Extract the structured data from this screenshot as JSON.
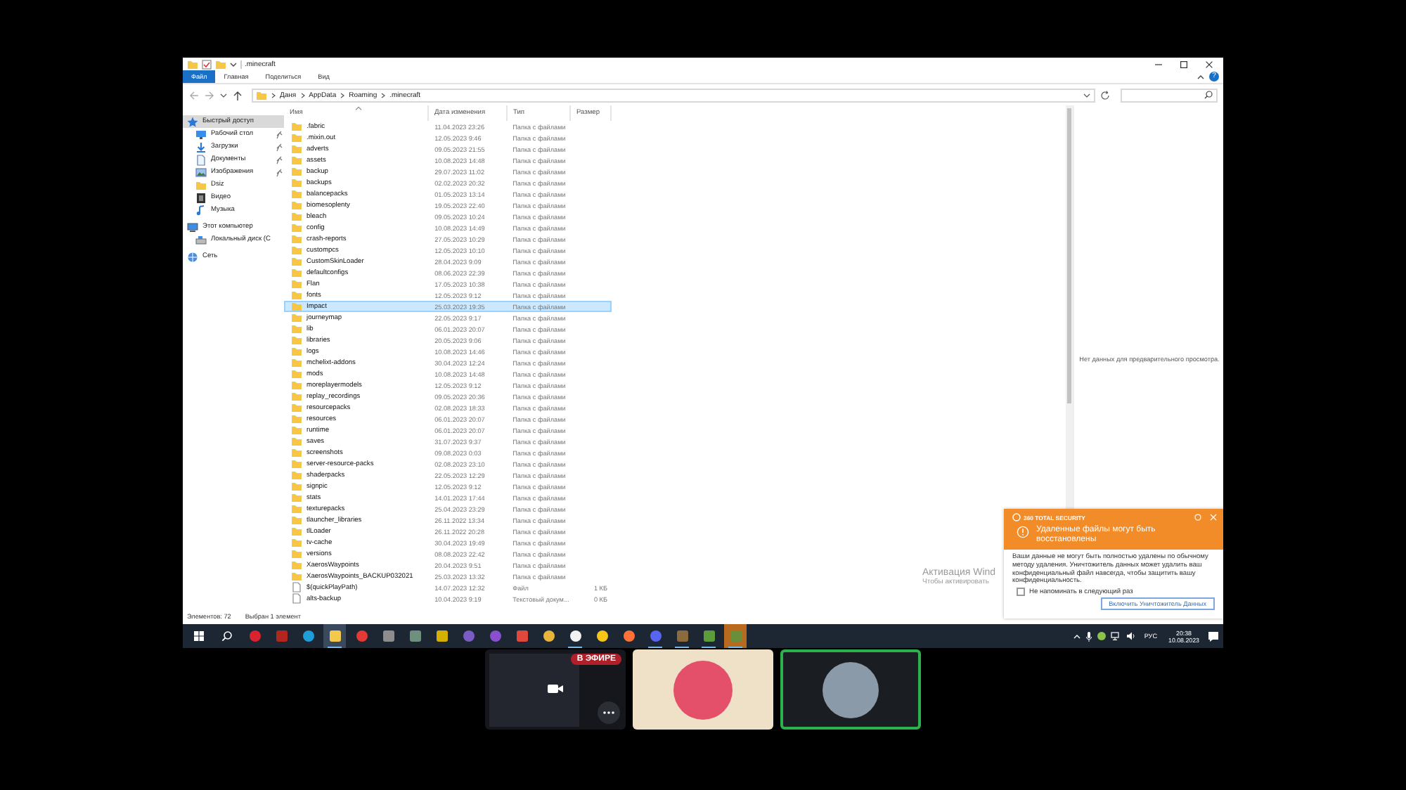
{
  "explorer": {
    "title": ".minecraft",
    "ribbon_tabs": [
      {
        "label": "Файл",
        "selected": true
      },
      {
        "label": "Главная",
        "selected": false
      },
      {
        "label": "Поделиться",
        "selected": false
      },
      {
        "label": "Вид",
        "selected": false
      }
    ],
    "help": "?",
    "breadcrumb": [
      "Даня",
      "AppData",
      "Roaming",
      ".minecraft"
    ],
    "nav": [
      {
        "label": "Быстрый доступ",
        "kind": "star",
        "selected": true,
        "pinned": false,
        "children": [
          {
            "label": "Рабочий стол",
            "kind": "desktop",
            "selected": false,
            "pinned": true
          },
          {
            "label": "Загрузки",
            "kind": "download",
            "selected": false,
            "pinned": true
          },
          {
            "label": "Документы",
            "kind": "document",
            "selected": false,
            "pinned": true
          },
          {
            "label": "Изображения",
            "kind": "picture",
            "selected": false,
            "pinned": true
          },
          {
            "label": "Dsiz",
            "kind": "folder",
            "selected": false,
            "pinned": false
          },
          {
            "label": "Видео",
            "kind": "video",
            "selected": false,
            "pinned": false
          },
          {
            "label": "Музыка",
            "kind": "music",
            "selected": false,
            "pinned": false
          }
        ]
      },
      {
        "label": "Этот компьютер",
        "kind": "computer",
        "selected": false,
        "pinned": false,
        "children": [
          {
            "label": "Локальный диск (C",
            "kind": "drive",
            "selected": false,
            "pinned": false
          }
        ]
      },
      {
        "label": "Сеть",
        "kind": "network",
        "selected": false,
        "pinned": false
      }
    ],
    "columns": [
      "Имя",
      "Дата изменения",
      "Тип",
      "Размер"
    ],
    "rows": [
      {
        "name": ".fabric",
        "date": "11.04.2023 23:26",
        "type": "Папка с файлами",
        "kind": "folder",
        "selected": false
      },
      {
        "name": ".mixin.out",
        "date": "12.05.2023 9:46",
        "type": "Папка с файлами",
        "kind": "folder",
        "selected": false
      },
      {
        "name": "adverts",
        "date": "09.05.2023 21:55",
        "type": "Папка с файлами",
        "kind": "folder",
        "selected": false
      },
      {
        "name": "assets",
        "date": "10.08.2023 14:48",
        "type": "Папка с файлами",
        "kind": "folder",
        "selected": false
      },
      {
        "name": "backup",
        "date": "29.07.2023 11:02",
        "type": "Папка с файлами",
        "kind": "folder",
        "selected": false
      },
      {
        "name": "backups",
        "date": "02.02.2023 20:32",
        "type": "Папка с файлами",
        "kind": "folder",
        "selected": false
      },
      {
        "name": "balancepacks",
        "date": "01.05.2023 13:14",
        "type": "Папка с файлами",
        "kind": "folder",
        "selected": false
      },
      {
        "name": "biomesoplenty",
        "date": "19.05.2023 22:40",
        "type": "Папка с файлами",
        "kind": "folder",
        "selected": false
      },
      {
        "name": "bleach",
        "date": "09.05.2023 10:24",
        "type": "Папка с файлами",
        "kind": "folder",
        "selected": false
      },
      {
        "name": "config",
        "date": "10.08.2023 14:49",
        "type": "Папка с файлами",
        "kind": "folder",
        "selected": false
      },
      {
        "name": "crash-reports",
        "date": "27.05.2023 10:29",
        "type": "Папка с файлами",
        "kind": "folder",
        "selected": false
      },
      {
        "name": "custompcs",
        "date": "12.05.2023 10:10",
        "type": "Папка с файлами",
        "kind": "folder",
        "selected": false
      },
      {
        "name": "CustomSkinLoader",
        "date": "28.04.2023 9:09",
        "type": "Папка с файлами",
        "kind": "folder",
        "selected": false
      },
      {
        "name": "defaultconfigs",
        "date": "08.06.2023 22:39",
        "type": "Папка с файлами",
        "kind": "folder",
        "selected": false
      },
      {
        "name": "Flan",
        "date": "17.05.2023 10:38",
        "type": "Папка с файлами",
        "kind": "folder",
        "selected": false
      },
      {
        "name": "fonts",
        "date": "12.05.2023 9:12",
        "type": "Папка с файлами",
        "kind": "folder",
        "selected": false
      },
      {
        "name": "Impact",
        "date": "25.03.2023 19:35",
        "type": "Папка с файлами",
        "kind": "folder",
        "selected": true
      },
      {
        "name": "journeymap",
        "date": "22.05.2023 9:17",
        "type": "Папка с файлами",
        "kind": "folder",
        "selected": false
      },
      {
        "name": "lib",
        "date": "06.01.2023 20:07",
        "type": "Папка с файлами",
        "kind": "folder",
        "selected": false
      },
      {
        "name": "libraries",
        "date": "20.05.2023 9:06",
        "type": "Папка с файлами",
        "kind": "folder",
        "selected": false
      },
      {
        "name": "logs",
        "date": "10.08.2023 14:46",
        "type": "Папка с файлами",
        "kind": "folder",
        "selected": false
      },
      {
        "name": "mchelixt-addons",
        "date": "30.04.2023 12:24",
        "type": "Папка с файлами",
        "kind": "folder",
        "selected": false
      },
      {
        "name": "mods",
        "date": "10.08.2023 14:48",
        "type": "Папка с файлами",
        "kind": "folder",
        "selected": false
      },
      {
        "name": "moreplayermodels",
        "date": "12.05.2023 9:12",
        "type": "Папка с файлами",
        "kind": "folder",
        "selected": false
      },
      {
        "name": "replay_recordings",
        "date": "09.05.2023 20:36",
        "type": "Папка с файлами",
        "kind": "folder",
        "selected": false
      },
      {
        "name": "resourcepacks",
        "date": "02.08.2023 18:33",
        "type": "Папка с файлами",
        "kind": "folder",
        "selected": false
      },
      {
        "name": "resources",
        "date": "06.01.2023 20:07",
        "type": "Папка с файлами",
        "kind": "folder",
        "selected": false
      },
      {
        "name": "runtime",
        "date": "06.01.2023 20:07",
        "type": "Папка с файлами",
        "kind": "folder",
        "selected": false
      },
      {
        "name": "saves",
        "date": "31.07.2023 9:37",
        "type": "Папка с файлами",
        "kind": "folder",
        "selected": false
      },
      {
        "name": "screenshots",
        "date": "09.08.2023 0:03",
        "type": "Папка с файлами",
        "kind": "folder",
        "selected": false
      },
      {
        "name": "server-resource-packs",
        "date": "02.08.2023 23:10",
        "type": "Папка с файлами",
        "kind": "folder",
        "selected": false
      },
      {
        "name": "shaderpacks",
        "date": "22.05.2023 12:29",
        "type": "Папка с файлами",
        "kind": "folder",
        "selected": false
      },
      {
        "name": "signpic",
        "date": "12.05.2023 9:12",
        "type": "Папка с файлами",
        "kind": "folder",
        "selected": false
      },
      {
        "name": "stats",
        "date": "14.01.2023 17:44",
        "type": "Папка с файлами",
        "kind": "folder",
        "selected": false
      },
      {
        "name": "texturepacks",
        "date": "25.04.2023 23:29",
        "type": "Папка с файлами",
        "kind": "folder",
        "selected": false
      },
      {
        "name": "tlauncher_libraries",
        "date": "26.11.2022 13:34",
        "type": "Папка с файлами",
        "kind": "folder",
        "selected": false
      },
      {
        "name": "tlLoader",
        "date": "26.11.2022 20:28",
        "type": "Папка с файлами",
        "kind": "folder",
        "selected": false
      },
      {
        "name": "tv-cache",
        "date": "30.04.2023 19:49",
        "type": "Папка с файлами",
        "kind": "folder",
        "selected": false
      },
      {
        "name": "versions",
        "date": "08.08.2023 22:42",
        "type": "Папка с файлами",
        "kind": "folder",
        "selected": false
      },
      {
        "name": "XaerosWaypoints",
        "date": "20.04.2023 9:51",
        "type": "Папка с файлами",
        "kind": "folder",
        "selected": false
      },
      {
        "name": "XaerosWaypoints_BACKUP032021",
        "date": "25.03.2023 13:32",
        "type": "Папка с файлами",
        "kind": "folder",
        "selected": false
      },
      {
        "name": "$(quickPlayPath)",
        "date": "14.07.2023 12:32",
        "type": "Файл",
        "size": "1 КБ",
        "kind": "file",
        "selected": false
      },
      {
        "name": "alts-backup",
        "date": "10.04.2023 9:19",
        "type": "Текстовый докум...",
        "size": "0 КБ",
        "kind": "file",
        "selected": false
      }
    ],
    "preview": "Нет данных для предварительного просмотра.",
    "status": [
      "Элементов: 72",
      "Выбран 1 элемент"
    ]
  },
  "activation": {
    "title": "Активация Wind",
    "subtitle": "Чтобы активировать"
  },
  "notification": {
    "brand": "360 TOTAL SECURITY",
    "title": "Удаленные файлы могут быть восстановлены",
    "body": "Ваши данные не могут быть полностью удалены по обычному методу удаления. Уничтожитель данных может удалить ваш конфиденциальный файл навсегда, чтобы защитить вашу конфиденциальность.",
    "checkbox": {
      "label": "Не напоминать в следующий раз",
      "checked": false
    },
    "button": "Включить Уничтожитель Данных"
  },
  "taskbar": {
    "apps": [
      {
        "kind": "circle",
        "color": "#d9232e",
        "open": false,
        "selected": false
      },
      {
        "kind": "square",
        "color": "#b3261e",
        "open": false,
        "selected": false
      },
      {
        "kind": "circle",
        "color": "#1f9ed8",
        "open": false,
        "selected": false
      },
      {
        "kind": "square",
        "color": "#f2c94c",
        "open": true,
        "selected": true
      },
      {
        "kind": "circle",
        "color": "#e53935",
        "open": false,
        "selected": false
      },
      {
        "kind": "square",
        "color": "#8d8d8d",
        "open": false,
        "selected": false
      },
      {
        "kind": "square",
        "color": "#6f8f7f",
        "open": false,
        "selected": false
      },
      {
        "kind": "square",
        "color": "#d4b100",
        "open": false,
        "selected": false
      },
      {
        "kind": "circle",
        "color": "#7b5cc4",
        "open": false,
        "selected": false
      },
      {
        "kind": "circle",
        "color": "#8a4fd1",
        "open": false,
        "selected": false
      },
      {
        "kind": "square",
        "color": "#e0483e",
        "open": false,
        "selected": false
      },
      {
        "kind": "circle",
        "color": "#e8b53a",
        "open": false,
        "selected": false
      },
      {
        "kind": "circle",
        "color": "#f2f2f2",
        "open": true,
        "selected": false
      },
      {
        "kind": "circle",
        "color": "#f5c518",
        "open": false,
        "selected": false
      },
      {
        "kind": "circle",
        "color": "#ff7139",
        "open": false,
        "selected": false
      },
      {
        "kind": "circle",
        "color": "#5865f2",
        "open": true,
        "selected": false
      },
      {
        "kind": "square",
        "color": "#8b6a3e",
        "open": true,
        "selected": false
      },
      {
        "kind": "square",
        "color": "#5d9c3a",
        "open": true,
        "selected": false
      },
      {
        "kind": "square",
        "color": "#6b8e3a",
        "open": true,
        "selected": true
      }
    ],
    "language": "РУС",
    "time": "20:38",
    "date": "10.08.2023"
  },
  "participants": [
    {
      "kind": "screen",
      "badge": "В ЭФИРЕ",
      "speaking": false
    },
    {
      "kind": "avatar",
      "speaking": false
    },
    {
      "kind": "photo",
      "speaking": true
    }
  ]
}
